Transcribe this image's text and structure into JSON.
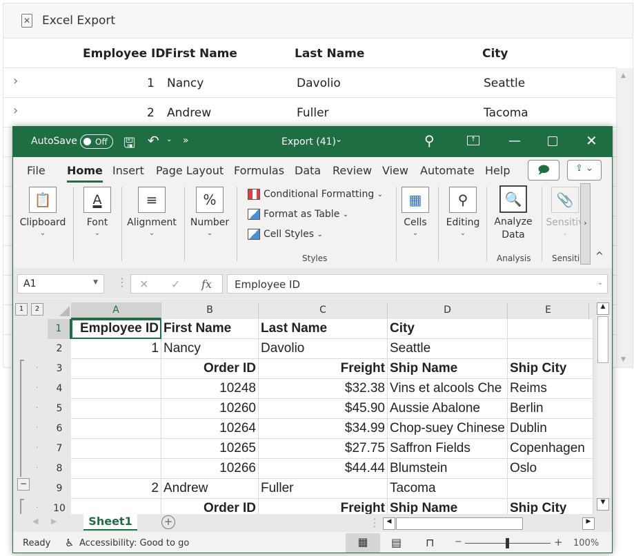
{
  "web": {
    "toolbar": {
      "export_label": "Excel Export",
      "icon": "excel-export-icon"
    },
    "grid": {
      "columns": [
        "Employee ID",
        "First Name",
        "Last Name",
        "City"
      ],
      "rows": [
        {
          "id": "1",
          "first": "Nancy",
          "last": "Davolio",
          "city": "Seattle"
        },
        {
          "id": "2",
          "first": "Andrew",
          "last": "Fuller",
          "city": "Tacoma"
        }
      ]
    }
  },
  "excel": {
    "titlebar": {
      "autosave_label": "AutoSave",
      "autosave_state": "Off",
      "title": "Export (41)",
      "more": "»"
    },
    "menu": [
      "File",
      "Home",
      "Insert",
      "Page Layout",
      "Formulas",
      "Data",
      "Review",
      "View",
      "Automate",
      "Help"
    ],
    "active_menu": "Home",
    "ribbon": {
      "groups": [
        "Clipboard",
        "Font",
        "Alignment",
        "Number"
      ],
      "styles_items": [
        "Conditional Formatting",
        "Format as Table",
        "Cell Styles"
      ],
      "styles_label": "Styles",
      "cells_label": "Cells",
      "editing_label": "Editing",
      "analyze_label_1": "Analyze",
      "analyze_label_2": "Data",
      "analysis_group": "Analysis",
      "sensitivity_label": "Sensitiv",
      "sensitivity_group": "Sensitiv"
    },
    "formula_bar": {
      "name_box": "A1",
      "value": "Employee ID",
      "fx": "fx"
    },
    "outline_levels": [
      "1",
      "2"
    ],
    "columns": [
      "A",
      "B",
      "C",
      "D",
      "E"
    ],
    "rows": [
      {
        "n": "1",
        "cells": [
          "Employee ID",
          "First Name",
          "Last Name",
          "City",
          ""
        ]
      },
      {
        "n": "2",
        "cells": [
          "1",
          "Nancy",
          "Davolio",
          "Seattle",
          ""
        ]
      },
      {
        "n": "3",
        "cells": [
          "",
          "Order ID",
          "Freight",
          "Ship Name",
          "Ship City"
        ]
      },
      {
        "n": "4",
        "cells": [
          "",
          "10248",
          "$32.38",
          "Vins et alcools Che",
          "Reims"
        ]
      },
      {
        "n": "5",
        "cells": [
          "",
          "10260",
          "$45.90",
          "Aussie Abalone",
          "Berlin"
        ]
      },
      {
        "n": "6",
        "cells": [
          "",
          "10264",
          "$34.99",
          "Chop-suey Chinese",
          "Dublin"
        ]
      },
      {
        "n": "7",
        "cells": [
          "",
          "10265",
          "$27.75",
          "Saffron Fields",
          "Copenhagen"
        ]
      },
      {
        "n": "8",
        "cells": [
          "",
          "10266",
          "$44.44",
          "Blumstein",
          "Oslo"
        ]
      },
      {
        "n": "9",
        "cells": [
          "2",
          "Andrew",
          "Fuller",
          "Tacoma",
          ""
        ]
      },
      {
        "n": "10",
        "cells": [
          "",
          "Order ID",
          "Freight",
          "Ship Name",
          "Ship City"
        ]
      }
    ],
    "sheet_tab": "Sheet1",
    "status": {
      "ready": "Ready",
      "accessibility": "Accessibility: Good to go",
      "zoom": "100%",
      "zoom_minus": "−",
      "zoom_plus": "+"
    },
    "accent": "#1f6e43"
  }
}
